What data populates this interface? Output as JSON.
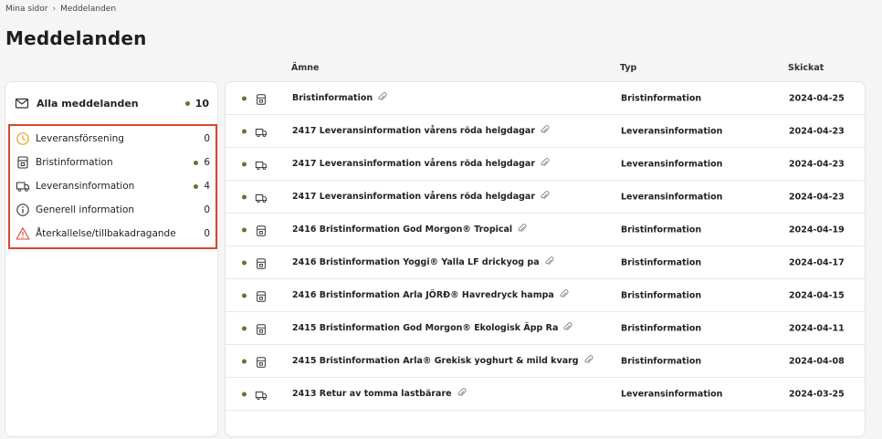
{
  "breadcrumb": {
    "root": "Mina sidor",
    "separator": "›",
    "current": "Meddelanden"
  },
  "page_title": "Meddelanden",
  "sidebar": {
    "all": {
      "label": "Alla meddelanden",
      "count": "10"
    },
    "categories": [
      {
        "label": "Leveransförsening",
        "count": "0",
        "icon": "clock-icon",
        "dot": false
      },
      {
        "label": "Bristinformation",
        "count": "6",
        "icon": "package-icon",
        "dot": true
      },
      {
        "label": "Leveransinformation",
        "count": "4",
        "icon": "truck-icon",
        "dot": true
      },
      {
        "label": "Generell information",
        "count": "0",
        "icon": "info-icon",
        "dot": false
      },
      {
        "label": "Återkallelse/tillbakadragande",
        "count": "0",
        "icon": "warning-icon",
        "dot": false
      }
    ]
  },
  "table": {
    "headers": {
      "subject": "Ämne",
      "type": "Typ",
      "sent": "Skickat"
    },
    "rows": [
      {
        "subject": "Bristinformation",
        "type": "Bristinformation",
        "date": "2024-04-25",
        "icon": "package-icon"
      },
      {
        "subject": "2417 Leveransinformation vårens röda helgdagar",
        "type": "Leveransinformation",
        "date": "2024-04-23",
        "icon": "truck-icon"
      },
      {
        "subject": "2417 Leveransinformation vårens röda helgdagar",
        "type": "Leveransinformation",
        "date": "2024-04-23",
        "icon": "truck-icon"
      },
      {
        "subject": "2417 Leveransinformation vårens röda helgdagar",
        "type": "Leveransinformation",
        "date": "2024-04-23",
        "icon": "truck-icon"
      },
      {
        "subject": "2416 Bristinformation God Morgon® Tropical",
        "type": "Bristinformation",
        "date": "2024-04-19",
        "icon": "package-icon"
      },
      {
        "subject": "2416 Bristinformation Yoggi® Yalla LF drickyog pa",
        "type": "Bristinformation",
        "date": "2024-04-17",
        "icon": "package-icon"
      },
      {
        "subject": "2416 Bristinformation Arla JÖRĐ® Havredryck hampa",
        "type": "Bristinformation",
        "date": "2024-04-15",
        "icon": "package-icon"
      },
      {
        "subject": "2415 Bristinformation God Morgon® Ekologisk Äpp Ra",
        "type": "Bristinformation",
        "date": "2024-04-11",
        "icon": "package-icon"
      },
      {
        "subject": "2415 Bristinformation Arla® Grekisk yoghurt & mild kvarg",
        "type": "Bristinformation",
        "date": "2024-04-08",
        "icon": "package-icon"
      },
      {
        "subject": "2413 Retur av tomma lastbärare",
        "type": "Leveransinformation",
        "date": "2024-03-25",
        "icon": "truck-icon"
      }
    ]
  },
  "colors": {
    "accent_dot": "#5b7a2a",
    "highlight_border": "#d9482b",
    "clock": "#e8a020",
    "warning": "#d9482b"
  }
}
